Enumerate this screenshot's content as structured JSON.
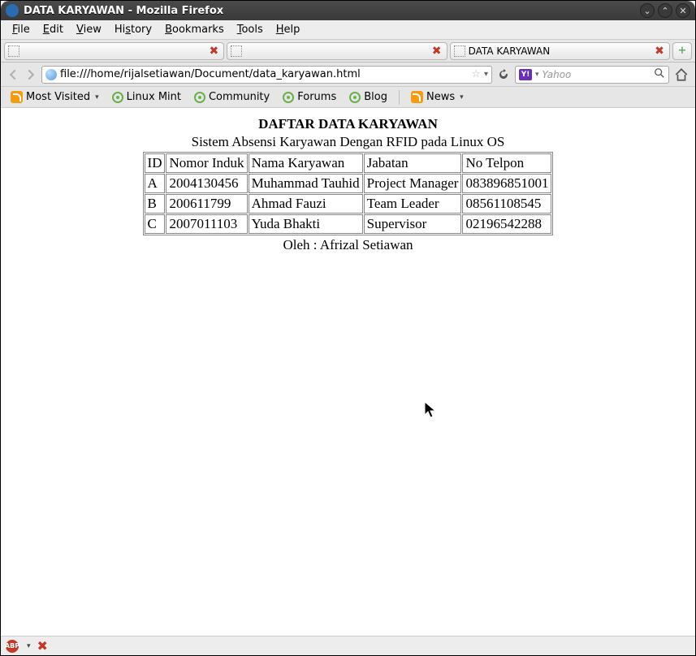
{
  "window": {
    "title": "DATA KARYAWAN - Mozilla Firefox"
  },
  "menu": {
    "file": "File",
    "edit": "Edit",
    "view": "View",
    "history": "History",
    "bookmarks": "Bookmarks",
    "tools": "Tools",
    "help": "Help"
  },
  "tabs": {
    "t1_label": "",
    "t2_label": "",
    "t3_label": "DATA KARYAWAN"
  },
  "address": {
    "url": "file:///home/rijalsetiawan/Document/data_karyawan.html"
  },
  "search": {
    "engine_short": "Y!",
    "placeholder": "Yahoo"
  },
  "bookmarks": {
    "most_visited": "Most Visited",
    "linux_mint": "Linux Mint",
    "community": "Community",
    "forums": "Forums",
    "blog": "Blog",
    "news": "News"
  },
  "page": {
    "title": "DAFTAR DATA KARYAWAN",
    "subtitle": "Sistem Absensi Karyawan Dengan RFID pada Linux OS",
    "headers": {
      "id": "ID",
      "ni": "Nomor Induk",
      "name": "Nama Karyawan",
      "pos": "Jabatan",
      "phone": "No Telpon"
    },
    "rows": [
      {
        "id": "A",
        "ni": "2004130456",
        "name": "Muhammad Tauhid",
        "pos": "Project Manager",
        "phone": "083896851001"
      },
      {
        "id": "B",
        "ni": "200611799",
        "name": "Ahmad Fauzi",
        "pos": "Team Leader",
        "phone": "08561108545"
      },
      {
        "id": "C",
        "ni": "2007011103",
        "name": "Yuda Bhakti",
        "pos": "Supervisor",
        "phone": "02196542288"
      }
    ],
    "author": "Oleh : Afrizal Setiawan"
  },
  "status": {
    "abp": "ABP"
  }
}
